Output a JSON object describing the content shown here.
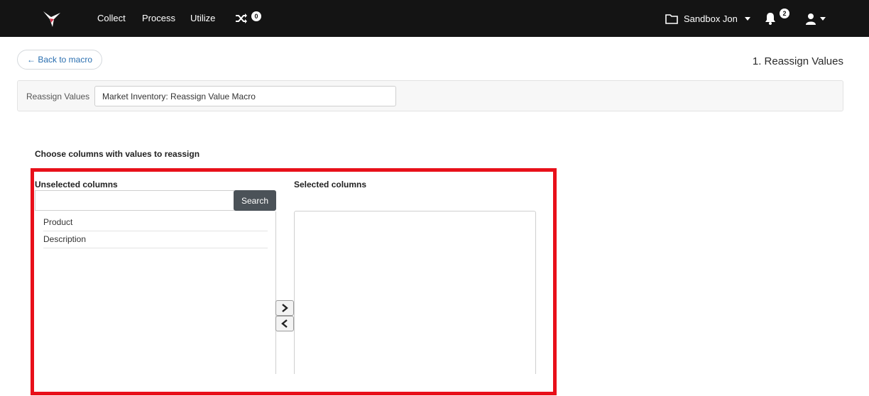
{
  "nav": {
    "logo_icon": "hummingbird-logo-icon",
    "items": [
      {
        "label": "Collect"
      },
      {
        "label": "Process"
      },
      {
        "label": "Utilize"
      }
    ],
    "shuffle_icon": "shuffle-icon",
    "shuffle_badge": "0",
    "workspace_icon": "folder-icon",
    "workspace_label": "Sandbox Jon",
    "notifications_icon": "bell-icon",
    "notifications_badge": "2",
    "user_icon": "user-icon"
  },
  "back_button": {
    "label": "← Back to macro"
  },
  "page_step": "1. Reassign Values",
  "name_panel": {
    "label": "Reassign Values",
    "value": "Market Inventory: Reassign Value Macro"
  },
  "section_title": "Choose columns with values to reassign",
  "unselected": {
    "header": "Unselected columns",
    "search_value": "",
    "search_button": "Search",
    "items": [
      {
        "label": "Product"
      },
      {
        "label": "Description"
      }
    ]
  },
  "selected": {
    "header": "Selected columns",
    "items": []
  },
  "controls": {
    "move_right_icon": "chevron-right-icon",
    "move_left_icon": "chevron-left-icon"
  },
  "colors": {
    "nav_bg": "#141414",
    "highlight": "#e8101a",
    "search_button_bg": "#4b5258",
    "link": "#2a6fb0"
  }
}
